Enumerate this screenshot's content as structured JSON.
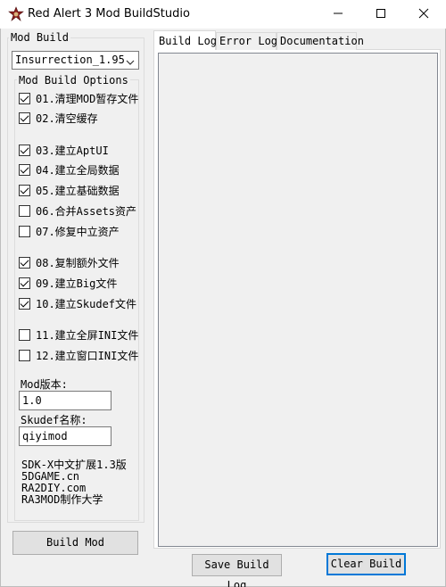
{
  "window": {
    "title": "Red Alert 3 Mod BuildStudio",
    "icon": "ra3-app-icon",
    "controls": [
      "minimize-icon",
      "maximize-icon",
      "close-icon"
    ]
  },
  "left_panel": {
    "group_label": "Mod Build",
    "mod_select": {
      "selected": "Insurrection_1.95",
      "icon": "chevron-down-icon"
    },
    "options_group_label": "Mod Build Options",
    "options": [
      {
        "label": "01.清理MOD暂存文件",
        "checked": true
      },
      {
        "label": "02.清空缓存",
        "checked": true
      },
      {
        "label": "03.建立AptUI",
        "checked": true
      },
      {
        "label": "04.建立全局数据",
        "checked": true
      },
      {
        "label": "05.建立基础数据",
        "checked": true
      },
      {
        "label": "06.合并Assets资产",
        "checked": false
      },
      {
        "label": "07.修复中立资产",
        "checked": false
      },
      {
        "label": "08.复制额外文件",
        "checked": true
      },
      {
        "label": "09.建立Big文件",
        "checked": true
      },
      {
        "label": "10.建立Skudef文件",
        "checked": true
      },
      {
        "label": "11.建立全屏INI文件",
        "checked": false
      },
      {
        "label": "12.建立窗口INI文件",
        "checked": false
      }
    ],
    "mod_version_label": "Mod版本:",
    "mod_version_value": "1.0",
    "skudef_label": "Skudef名称:",
    "skudef_value": "qiyimod",
    "credits": [
      "SDK-X中文扩展1.3版",
      "5DGAME.cn",
      "RA2DIY.com",
      "RA3MOD制作大学"
    ],
    "build_button": "Build Mod"
  },
  "right_panel": {
    "tabs": [
      {
        "label": "Build Log",
        "active": true
      },
      {
        "label": "Error Log",
        "active": false
      },
      {
        "label": "Documentation",
        "active": false
      }
    ],
    "log_text": "",
    "save_button": "Save Build Log",
    "clear_button": "Clear Build"
  },
  "colors": {
    "window_bg": "#f0f0f0",
    "focus_border": "#0078d7",
    "button_bg": "#e1e1e1"
  }
}
